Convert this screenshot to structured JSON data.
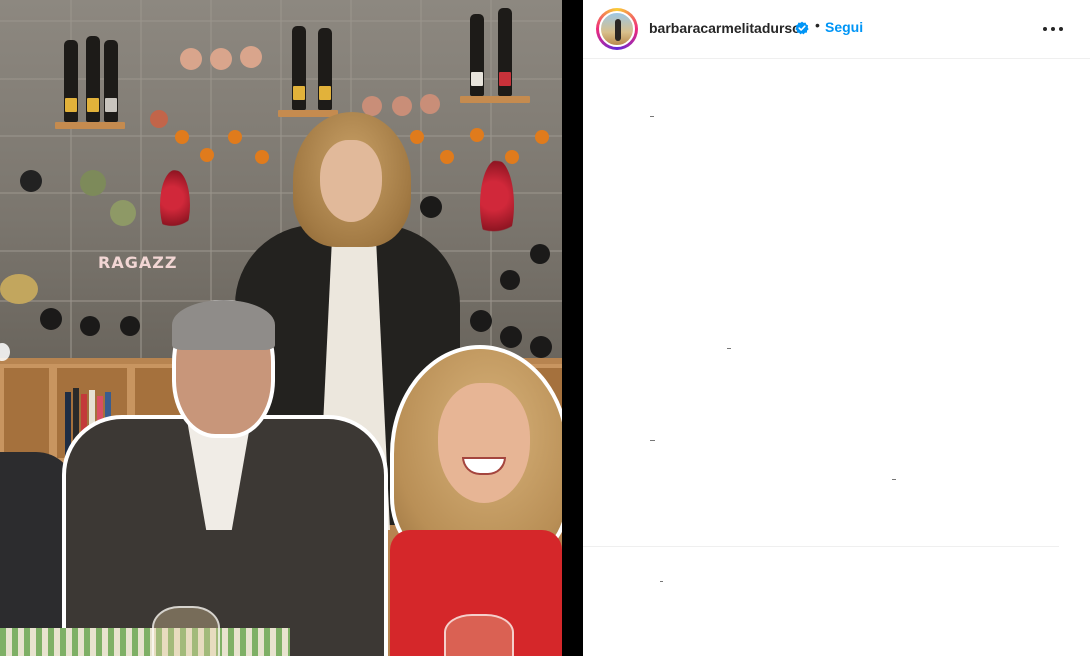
{
  "post": {
    "author": {
      "username": "barbaracarmelitadurso",
      "verified": true,
      "follow_label": "Segui",
      "separator": "•"
    },
    "more_icon": "more-options-icon",
    "media": {
      "overlay_text": "RAGAZZ"
    }
  },
  "colors": {
    "follow_blue": "#0095f6",
    "verified_blue": "#0095f6",
    "text_primary": "#262626",
    "divider": "#000000"
  }
}
